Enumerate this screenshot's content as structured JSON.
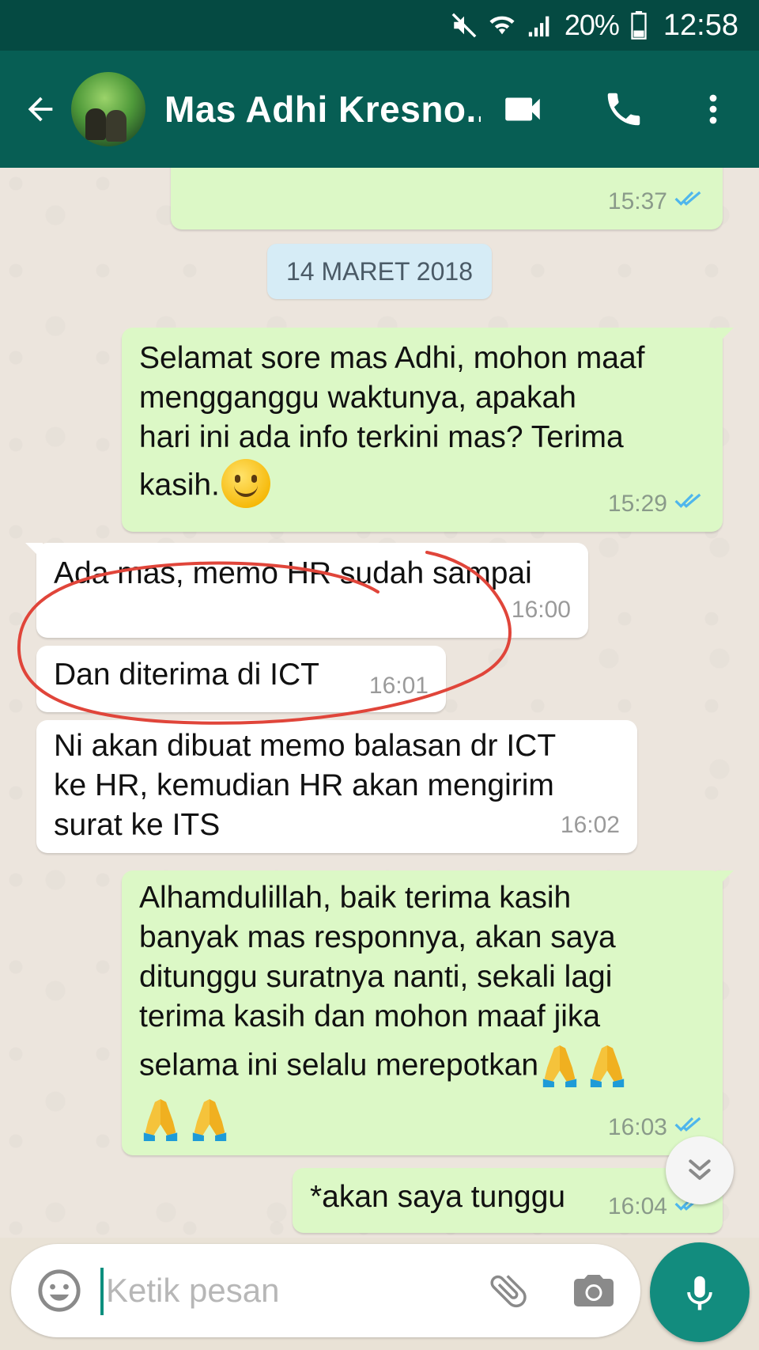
{
  "status_bar": {
    "battery": "20%",
    "time": "12:58"
  },
  "header": {
    "contact_name": "Mas Adhi Kresno...",
    "icons": [
      "back-arrow-icon",
      "video-call-icon",
      "phone-icon",
      "more-vert-icon"
    ],
    "colors": {
      "status_bar": "#054a42",
      "app_bar": "#075e54"
    }
  },
  "chat": {
    "date_divider": "14 MARET 2018",
    "messages": [
      {
        "direction": "out",
        "lines": [],
        "time": "15:37",
        "ticks": "read"
      },
      {
        "direction": "out",
        "lines": [
          "Selamat sore mas Adhi, mohon maaf",
          "mengganggu waktunya, apakah",
          "hari ini ada info terkini mas? Terima",
          "kasih."
        ],
        "emoji": [
          "smiling-face-emoji"
        ],
        "time": "15:29",
        "ticks": "read"
      },
      {
        "direction": "in",
        "lines": [
          "Ada mas, memo HR sudah sampai"
        ],
        "time": "16:00"
      },
      {
        "direction": "in",
        "lines": [
          "Dan diterima di ICT"
        ],
        "time": "16:01"
      },
      {
        "direction": "in",
        "lines": [
          "Ni akan dibuat memo balasan dr ICT",
          "ke HR, kemudian HR akan mengirim",
          "surat ke ITS"
        ],
        "time": "16:02"
      },
      {
        "direction": "out",
        "lines": [
          "Alhamdulillah, baik terima kasih",
          "banyak mas responnya, akan saya",
          "ditunggu suratnya nanti, sekali lagi",
          "terima kasih dan mohon maaf jika",
          "selama ini selalu merepotkan"
        ],
        "emoji": [
          "folded-hands-emoji",
          "folded-hands-emoji",
          "folded-hands-emoji",
          "folded-hands-emoji"
        ],
        "time": "16:03",
        "ticks": "read"
      },
      {
        "direction": "out",
        "lines": [
          "*akan saya tunggu"
        ],
        "time": "16:04",
        "ticks": "read"
      }
    ],
    "colors": {
      "outgoing": "#dcf8c6",
      "incoming": "#ffffff",
      "read_ticks": "#4fb6ec",
      "annotation": "#e0453a"
    }
  },
  "composer": {
    "placeholder": "Ketik pesan",
    "icons": [
      "emoji-icon",
      "attach-icon",
      "camera-icon",
      "mic-icon"
    ],
    "accent": "#128c7e"
  }
}
